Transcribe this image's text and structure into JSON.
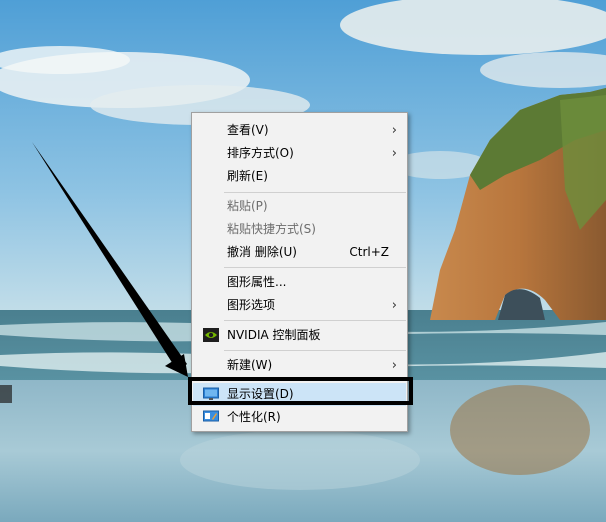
{
  "context_menu": {
    "items": [
      {
        "label": "查看(V)",
        "has_submenu": true,
        "disabled": false
      },
      {
        "label": "排序方式(O)",
        "has_submenu": true,
        "disabled": false
      },
      {
        "label": "刷新(E)",
        "disabled": false
      },
      {
        "label": "粘贴(P)",
        "disabled": true
      },
      {
        "label": "粘贴快捷方式(S)",
        "disabled": true
      },
      {
        "label": "撤消 删除(U)",
        "shortcut": "Ctrl+Z",
        "disabled": false
      },
      {
        "label": "图形属性...",
        "disabled": false
      },
      {
        "label": "图形选项",
        "has_submenu": true,
        "disabled": false
      },
      {
        "label": "NVIDIA 控制面板",
        "icon": "nvidia-icon",
        "disabled": false
      },
      {
        "label": "新建(W)",
        "has_submenu": true,
        "disabled": false
      },
      {
        "label": "显示设置(D)",
        "icon": "display-icon",
        "disabled": false,
        "highlighted": true
      },
      {
        "label": "个性化(R)",
        "icon": "personalize-icon",
        "disabled": false
      }
    ]
  },
  "annotation": {
    "color": "#000000"
  }
}
